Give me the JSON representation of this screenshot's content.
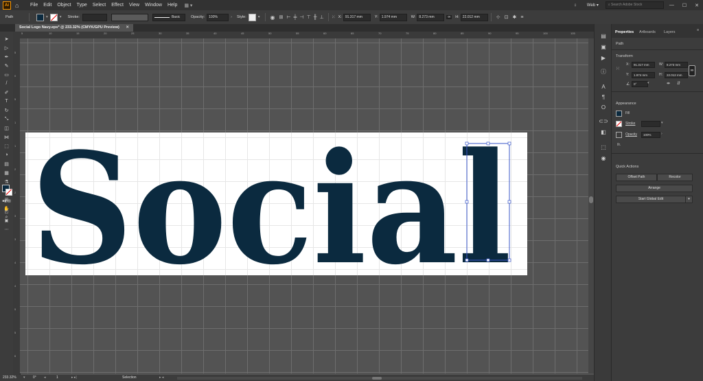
{
  "menubar": {
    "items": [
      "File",
      "Edit",
      "Object",
      "Type",
      "Select",
      "Effect",
      "View",
      "Window",
      "Help"
    ],
    "workspace": "Web",
    "search_placeholder": "Search Adobe Stock"
  },
  "control": {
    "object_type": "Path",
    "stroke_label": "Stroke:",
    "brush_label": "Basic",
    "opacity_label": "Opacity:",
    "opacity_value": "100%",
    "style_label": "Style:",
    "x_label": "X:",
    "x_value": "91.317 mm",
    "y_label": "Y:",
    "y_value": "1.974 mm",
    "w_label": "W:",
    "w_value": "8.273 mm",
    "h_label": "H:",
    "h_value": "22.012 mm"
  },
  "document": {
    "tab_title": "Social Logo Navy.eps* @ 233.32% (CMYK/GPU Preview)"
  },
  "artwork": {
    "text": "Social",
    "color": "#0b2a3f"
  },
  "ruler": {
    "h_ticks": [
      "5",
      "10",
      "15",
      "20",
      "25",
      "30",
      "35",
      "40",
      "45",
      "50",
      "55",
      "60",
      "65",
      "70",
      "75",
      "80",
      "85",
      "90",
      "95",
      "100",
      "105"
    ],
    "v_ticks": [
      "5",
      "0",
      "5",
      "1",
      "1",
      "2",
      "2",
      "3",
      "3",
      "4",
      "4",
      "5",
      "5",
      "6"
    ]
  },
  "status": {
    "zoom": "233.32%",
    "angle": "0°",
    "artboard_num": "1",
    "tool_name": "Selection"
  },
  "panel": {
    "tabs": [
      "Properties",
      "Artboards",
      "Layers"
    ],
    "object_type": "Path",
    "transform_title": "Transform",
    "x_label": "X:",
    "x_value": "91.317 mm",
    "y_label": "Y:",
    "y_value": "1.974 mm",
    "w_label": "W:",
    "w_value": "8.273 mm",
    "h_label": "H:",
    "h_value": "22.012 mm",
    "angle_value": "0°",
    "appearance_title": "Appearance",
    "fill_label": "Fill",
    "stroke_label": "Stroke",
    "opacity_label": "Opacity",
    "opacity_value": "100%",
    "fx_label": "fx.",
    "quick_actions_title": "Quick Actions",
    "offset_path": "Offset Path",
    "recolor": "Recolor",
    "arrange": "Arrange",
    "start_global_edit": "Start Global Edit"
  },
  "colors": {
    "navy": "#0b2a3f",
    "selection": "#3a57c9",
    "canvas": "#535353"
  }
}
